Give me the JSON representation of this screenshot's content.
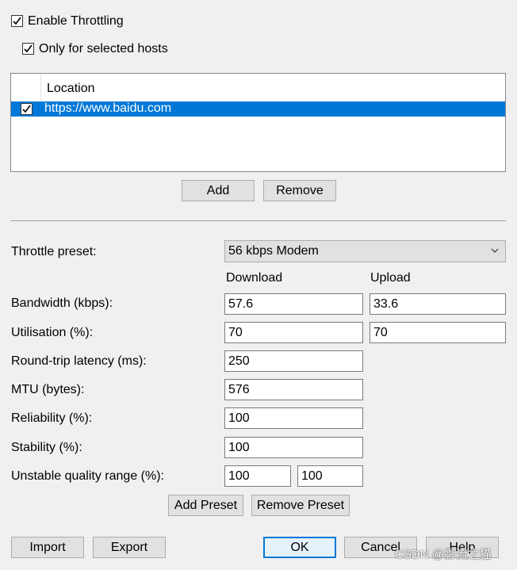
{
  "throttling": {
    "enable_label": "Enable Throttling",
    "enable_checked": true,
    "only_selected_label": "Only for selected hosts",
    "only_selected_checked": true
  },
  "hosts": {
    "column_header": "Location",
    "rows": [
      {
        "checked": true,
        "url": "https://www.baidu.com",
        "selected": true
      }
    ],
    "add_label": "Add",
    "remove_label": "Remove"
  },
  "settings": {
    "preset_label": "Throttle preset:",
    "preset_value": "56 kbps Modem",
    "download_header": "Download",
    "upload_header": "Upload",
    "bandwidth_label": "Bandwidth (kbps):",
    "bandwidth_download": "57.6",
    "bandwidth_upload": "33.6",
    "utilisation_label": "Utilisation (%):",
    "utilisation_download": "70",
    "utilisation_upload": "70",
    "latency_label": "Round-trip latency (ms):",
    "latency_value": "250",
    "mtu_label": "MTU (bytes):",
    "mtu_value": "576",
    "reliability_label": "Reliability (%):",
    "reliability_value": "100",
    "stability_label": "Stability (%):",
    "stability_value": "100",
    "unstable_label": "Unstable quality range (%):",
    "unstable_min": "100",
    "unstable_max": "100",
    "add_preset_label": "Add Preset",
    "remove_preset_label": "Remove Preset"
  },
  "footer": {
    "import_label": "Import",
    "export_label": "Export",
    "ok_label": "OK",
    "cancel_label": "Cancel",
    "help_label": "Help",
    "watermark": "CSDN @影流之猫"
  },
  "colors": {
    "selection": "#0078d7",
    "dialog_bg": "#f0f0f0"
  },
  "icons": {
    "checkbox": "checkmark-icon",
    "dropdown": "chevron-down-icon"
  }
}
